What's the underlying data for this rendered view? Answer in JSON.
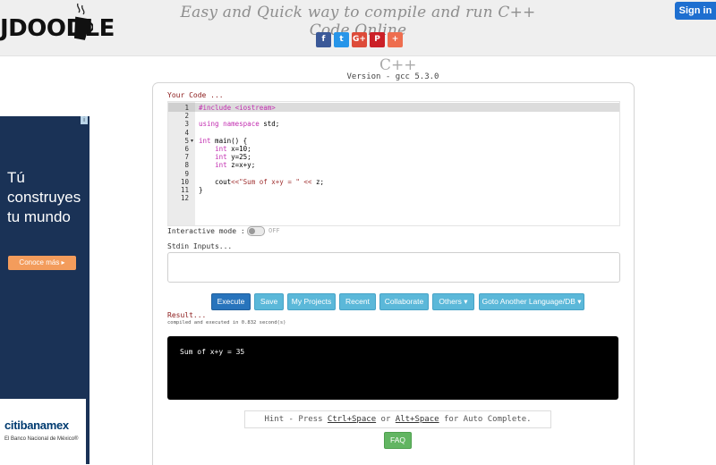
{
  "header": {
    "logo_text": "JDOODLE",
    "tagline": "Easy and Quick way to compile and run C++ Code Online",
    "signin_label": "Sign in",
    "social": [
      {
        "name": "facebook",
        "glyph": "f"
      },
      {
        "name": "twitter",
        "glyph": "t"
      },
      {
        "name": "google-plus",
        "glyph": "G+"
      },
      {
        "name": "pinterest",
        "glyph": "P"
      },
      {
        "name": "more",
        "glyph": "+"
      }
    ]
  },
  "language": {
    "logo": "C++",
    "version": "Version - gcc 5.3.0"
  },
  "editor": {
    "label": "Your Code ...",
    "lines": [
      {
        "n": "1",
        "code": "#include <iostream>"
      },
      {
        "n": "2",
        "code": ""
      },
      {
        "n": "3",
        "code": "using namespace std;"
      },
      {
        "n": "4",
        "code": ""
      },
      {
        "n": "5",
        "code": "int main() {"
      },
      {
        "n": "6",
        "code": "    int x=10;"
      },
      {
        "n": "7",
        "code": "    int y=25;"
      },
      {
        "n": "8",
        "code": "    int z=x+y;"
      },
      {
        "n": "9",
        "code": ""
      },
      {
        "n": "10",
        "code": "    cout<<\"Sum of x+y = \" << z;"
      },
      {
        "n": "11",
        "code": "}"
      },
      {
        "n": "12",
        "code": ""
      }
    ]
  },
  "interactive": {
    "label": "Interactive mode :",
    "state": "OFF"
  },
  "stdin": {
    "label": "Stdin Inputs...",
    "value": ""
  },
  "toolbar": {
    "execute": "Execute",
    "save": "Save",
    "my_projects": "My Projects",
    "recent": "Recent",
    "collaborate": "Collaborate",
    "others": "Others ▾",
    "goto_language": "Goto Another Language/DB ▾"
  },
  "result": {
    "label": "Result...",
    "compiled_text": "compiled and executed in 0.832 second(s)",
    "output": "Sum of x+y = 35"
  },
  "hint": {
    "prefix": "Hint - Press ",
    "key1": "Ctrl+Space",
    "mid": " or ",
    "key2": "Alt+Space",
    "suffix": " for Auto Complete."
  },
  "faq_label": "FAQ",
  "ad": {
    "corner": "i",
    "headline": "Tú construyes tu mundo",
    "cta": "Conoce más ▸",
    "brand": "citibanamex",
    "sub": "El Banco Nacional de México®"
  },
  "colors": {
    "accent": "#2874bc",
    "button": "#5bb8d9",
    "faq": "#62b562",
    "label": "#8b1a1a"
  }
}
